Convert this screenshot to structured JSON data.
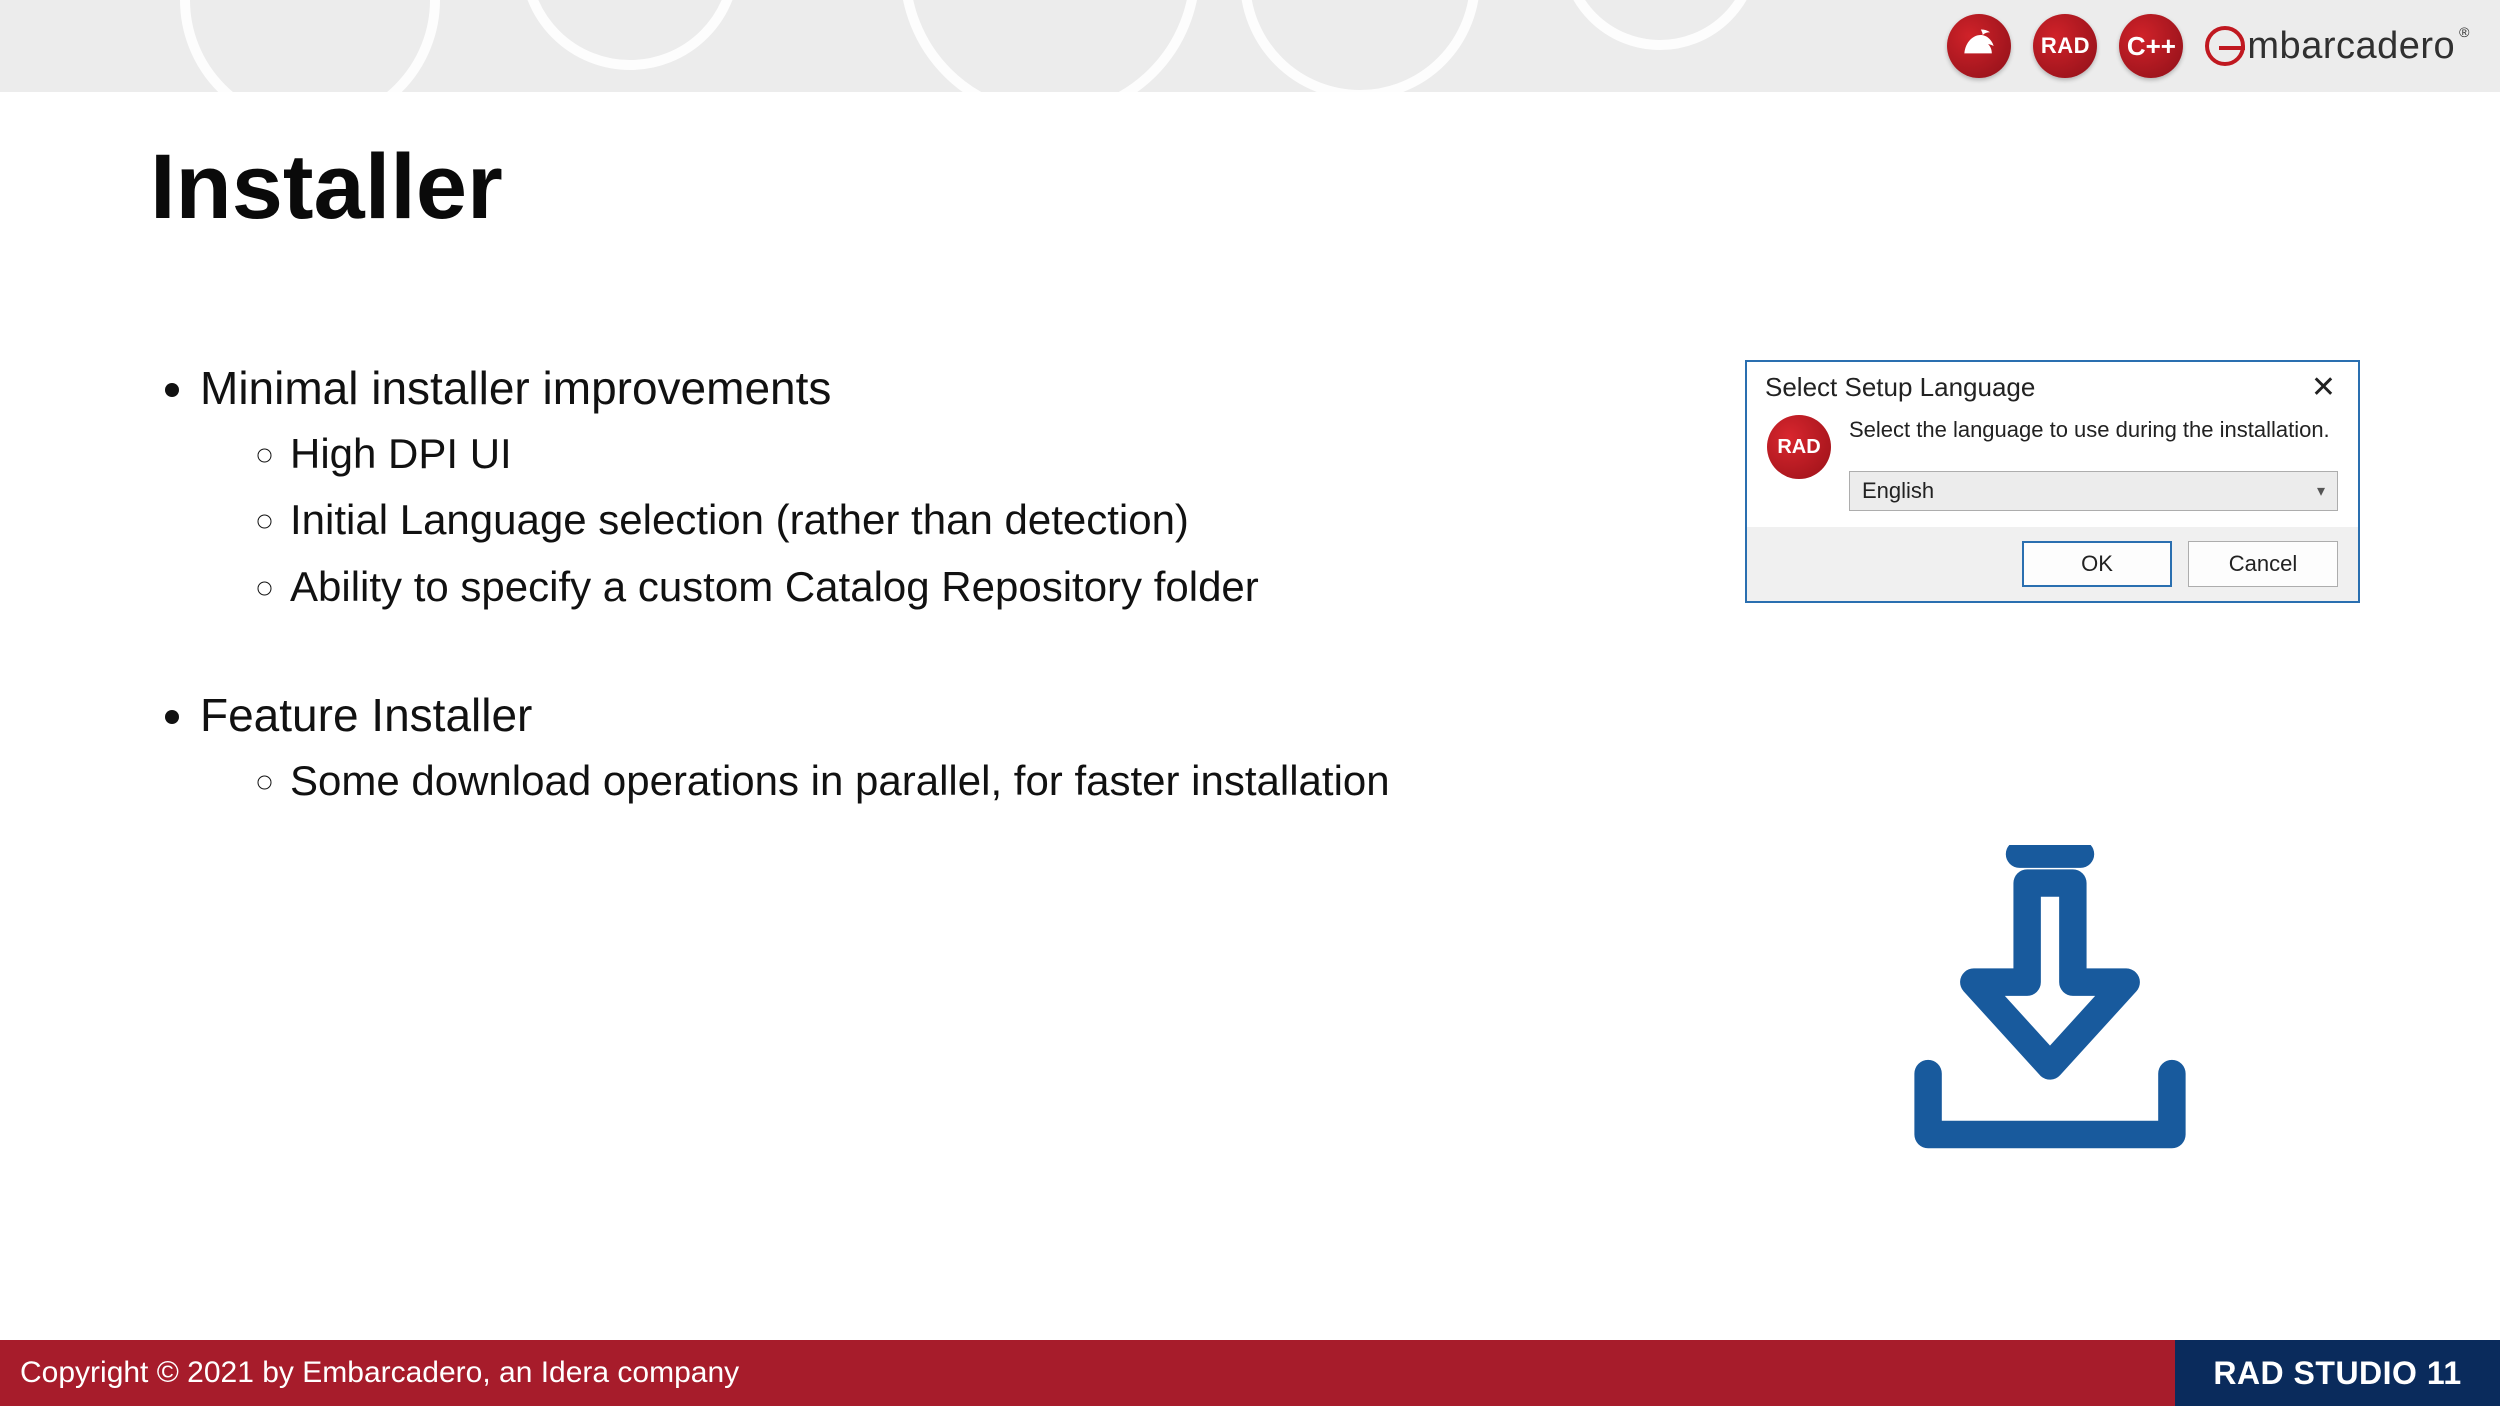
{
  "header": {
    "logos": {
      "delphi_alt": "Delphi helmet",
      "rad_label": "RAD",
      "cpp_label": "C++",
      "embarcadero_word": "mbarcadero",
      "embarcadero_reg": "®"
    }
  },
  "title": "Installer",
  "bullets": [
    {
      "text": "Minimal installer improvements",
      "sub": [
        "High DPI UI",
        "Initial Language selection (rather than detection)",
        "Ability to specify a custom Catalog Repository folder"
      ]
    },
    {
      "text": "Feature Installer",
      "sub": [
        "Some download operations in parallel, for faster installation"
      ]
    }
  ],
  "dialog": {
    "title": "Select Setup Language",
    "close_glyph": "✕",
    "icon_label": "RAD",
    "message": "Select the language to use during the installation.",
    "selected_language": "English",
    "ok_label": "OK",
    "cancel_label": "Cancel"
  },
  "download_icon_alt": "download",
  "footer": {
    "copyright": "Copyright © 2021 by Embarcadero, an Idera company",
    "product": "RAD STUDIO 11"
  }
}
